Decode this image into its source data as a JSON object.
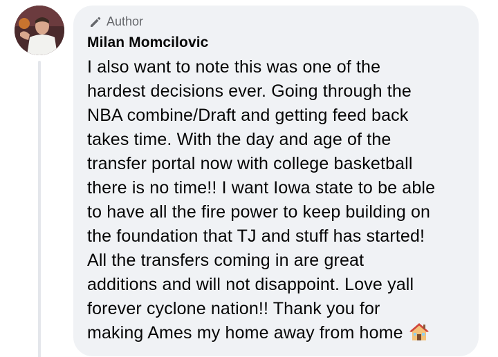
{
  "comment": {
    "badge": {
      "icon": "pencil-icon",
      "label": "Author"
    },
    "author_name": "Milan Momcilovic",
    "body_lines": [
      "I also want to note this was one of the",
      "hardest decisions ever. Going through the",
      "NBA combine/Draft and getting feed back",
      "takes time. With the day and age of the",
      "transfer portal now with college basketball",
      "there is no time!! I want Iowa state to be able",
      "to have all the fire power to keep building on",
      "the foundation that TJ and stuff has started!",
      "All the transfers coming in are great",
      "additions and will not disappoint. Love yall",
      "forever cyclone nation!! Thank you for",
      "making Ames my home away from home"
    ],
    "trailing_emoji": "house-emoji"
  },
  "colors": {
    "bubble_background": "#f0f2f5",
    "primary_text": "#050505",
    "secondary_text": "#65676b",
    "thread_line": "#e4e6eb"
  }
}
